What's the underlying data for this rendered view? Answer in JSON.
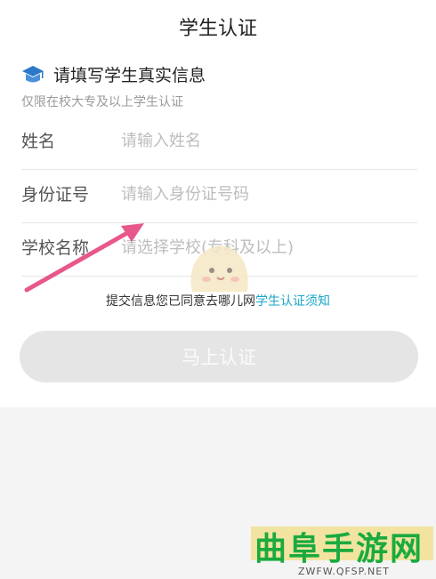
{
  "header": {
    "title": "学生认证"
  },
  "intro": {
    "icon": "graduation-cap-icon",
    "heading": "请填写学生真实信息",
    "note": "仅限在校大专及以上学生认证"
  },
  "form": {
    "name": {
      "label": "姓名",
      "placeholder": "请输入姓名",
      "value": ""
    },
    "id_number": {
      "label": "身份证号",
      "placeholder": "请输入身份证号码",
      "value": ""
    },
    "school": {
      "label": "学校名称",
      "placeholder": "请选择学校(专科及以上)",
      "value": ""
    }
  },
  "agreement": {
    "prefix": "提交信息您已同意去哪儿网",
    "link": "学生认证须知"
  },
  "submit": {
    "label": "马上认证",
    "state": "disabled"
  },
  "watermark": {
    "text": "曲阜手游网",
    "url": "ZWFW.QFSP.NET"
  },
  "colors": {
    "link": "#1aa7c9",
    "button_disabled": "#e5e5e5",
    "arrow": "#e8578c",
    "icon": "#2b78c9"
  }
}
